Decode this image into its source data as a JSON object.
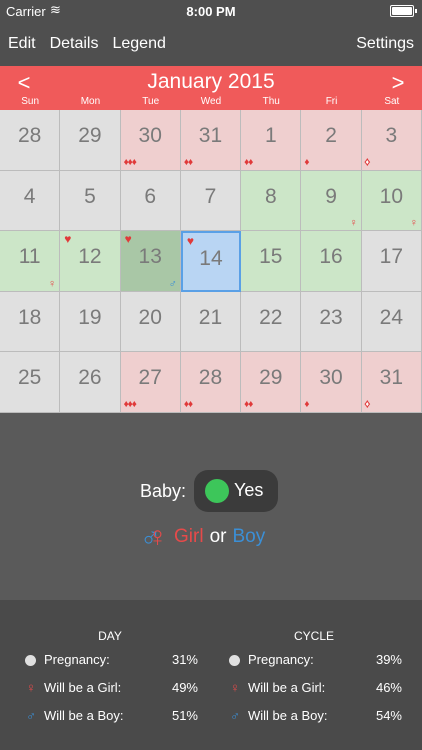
{
  "status_bar": {
    "carrier": "Carrier",
    "time": "8:00 PM"
  },
  "nav": {
    "edit": "Edit",
    "details": "Details",
    "legend": "Legend",
    "settings": "Settings"
  },
  "calendar": {
    "month_title": "January 2015",
    "prev": "<",
    "next": ">",
    "weekdays": [
      "Sun",
      "Mon",
      "Tue",
      "Wed",
      "Thu",
      "Fri",
      "Sat"
    ],
    "weeks": [
      [
        {
          "day": "28",
          "style": "plain"
        },
        {
          "day": "29",
          "style": "plain"
        },
        {
          "day": "30",
          "style": "pink",
          "drops": "♦♦♦"
        },
        {
          "day": "31",
          "style": "pink",
          "drops": "♦♦"
        },
        {
          "day": "1",
          "style": "pink",
          "drops": "♦♦"
        },
        {
          "day": "2",
          "style": "pink",
          "drops": "♦"
        },
        {
          "day": "3",
          "style": "pink",
          "drops": "♦",
          "outline": true
        }
      ],
      [
        {
          "day": "4",
          "style": "plain"
        },
        {
          "day": "5",
          "style": "plain"
        },
        {
          "day": "6",
          "style": "plain"
        },
        {
          "day": "7",
          "style": "plain"
        },
        {
          "day": "8",
          "style": "green"
        },
        {
          "day": "9",
          "style": "green",
          "sym": "♀",
          "symtype": "girl"
        },
        {
          "day": "10",
          "style": "green",
          "sym": "♀",
          "symtype": "girl"
        }
      ],
      [
        {
          "day": "11",
          "style": "green",
          "sym": "♀",
          "symtype": "girl"
        },
        {
          "day": "12",
          "style": "green",
          "heart": "♥"
        },
        {
          "day": "13",
          "style": "dgreen",
          "heart": "♥",
          "sym": "♂",
          "symtype": "boy"
        },
        {
          "day": "14",
          "style": "selected",
          "heart": "♥"
        },
        {
          "day": "15",
          "style": "green"
        },
        {
          "day": "16",
          "style": "green"
        },
        {
          "day": "17",
          "style": "plain"
        }
      ],
      [
        {
          "day": "18",
          "style": "plain"
        },
        {
          "day": "19",
          "style": "plain"
        },
        {
          "day": "20",
          "style": "plain"
        },
        {
          "day": "21",
          "style": "plain"
        },
        {
          "day": "22",
          "style": "plain"
        },
        {
          "day": "23",
          "style": "plain"
        },
        {
          "day": "24",
          "style": "plain"
        }
      ],
      [
        {
          "day": "25",
          "style": "plain"
        },
        {
          "day": "26",
          "style": "plain"
        },
        {
          "day": "27",
          "style": "pink",
          "drops": "♦♦♦"
        },
        {
          "day": "28",
          "style": "pink",
          "drops": "♦♦"
        },
        {
          "day": "29",
          "style": "pink",
          "drops": "♦♦"
        },
        {
          "day": "30",
          "style": "pink",
          "drops": "♦"
        },
        {
          "day": "31",
          "style": "pink",
          "drops": "♦",
          "outline": true
        }
      ]
    ]
  },
  "baby": {
    "label": "Baby:",
    "toggle_text": "Yes",
    "toggle_on": true,
    "girl": "Girl",
    "or": "or",
    "boy": "Boy"
  },
  "stats": {
    "day": {
      "title": "DAY",
      "rows": [
        {
          "icon": "circle",
          "label": "Pregnancy:",
          "value": "31%"
        },
        {
          "icon": "♀",
          "label": "Will be a Girl:",
          "value": "49%"
        },
        {
          "icon": "♂",
          "label": "Will be a Boy:",
          "value": "51%"
        }
      ]
    },
    "cycle": {
      "title": "CYCLE",
      "rows": [
        {
          "icon": "circle",
          "label": "Pregnancy:",
          "value": "39%"
        },
        {
          "icon": "♀",
          "label": "Will be a Girl:",
          "value": "46%"
        },
        {
          "icon": "♂",
          "label": "Will be a Boy:",
          "value": "54%"
        }
      ]
    }
  },
  "colors": {
    "accent": "#f05a5a",
    "girl": "#e64a4a",
    "boy": "#3b8fd6",
    "toggle_on": "#3dc65a"
  }
}
